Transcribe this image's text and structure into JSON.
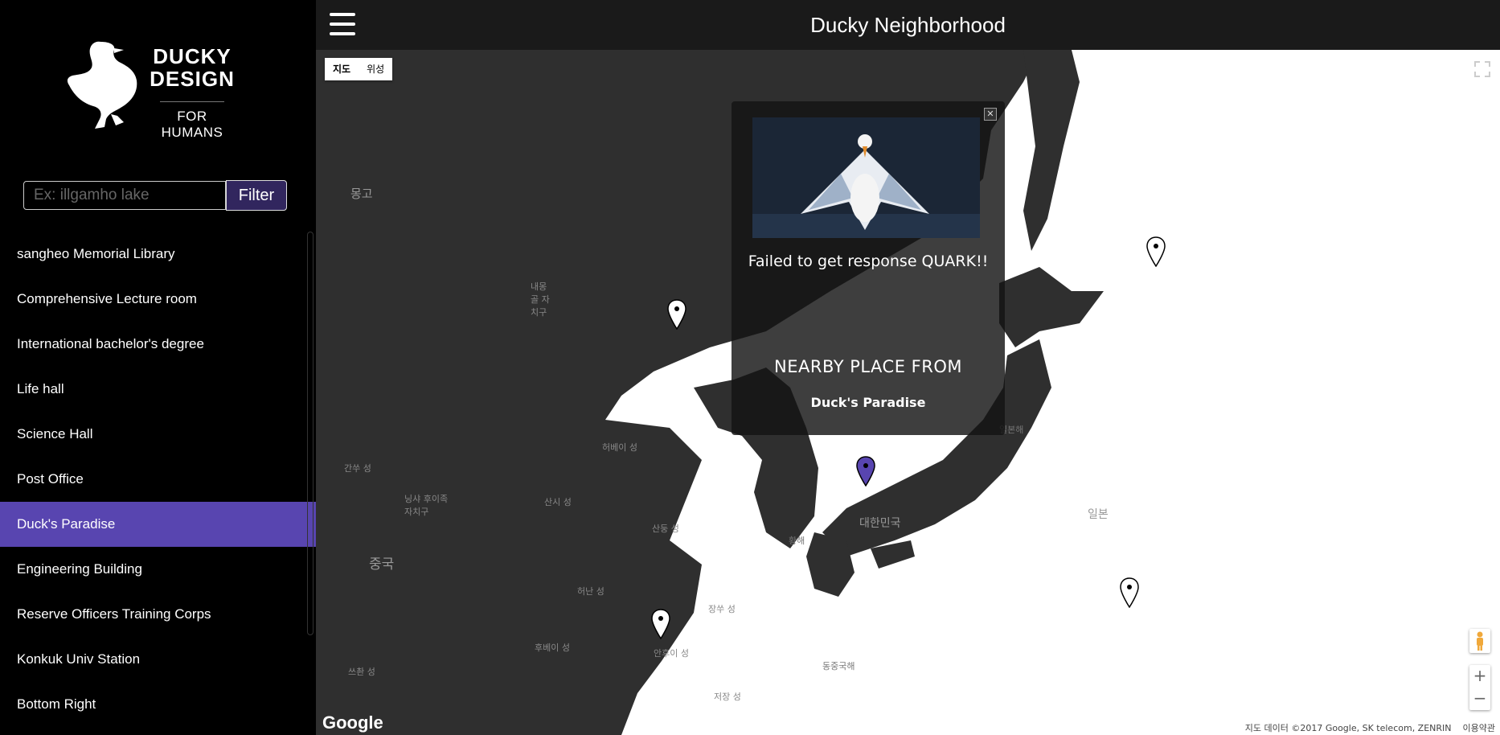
{
  "logo": {
    "line1": "DUCKY",
    "line2": "DESIGN",
    "subtitle": "FOR HUMANS",
    "icon": "duck-icon"
  },
  "filter": {
    "placeholder": "Ex: illgamho lake",
    "value": "",
    "button_label": "Filter"
  },
  "places": [
    {
      "label": "sangheo Memorial Library",
      "active": false
    },
    {
      "label": "Comprehensive Lecture room",
      "active": false
    },
    {
      "label": "International bachelor's degree",
      "active": false
    },
    {
      "label": "Life hall",
      "active": false
    },
    {
      "label": "Science Hall",
      "active": false
    },
    {
      "label": "Post Office",
      "active": false
    },
    {
      "label": "Duck's Paradise",
      "active": true
    },
    {
      "label": "Engineering Building",
      "active": false
    },
    {
      "label": "Reserve Officers Training Corps",
      "active": false
    },
    {
      "label": "Konkuk Univ Station",
      "active": false
    },
    {
      "label": "Bottom Right",
      "active": false
    }
  ],
  "header": {
    "title": "Ducky Neighborhood",
    "menu_icon": "hamburger-icon"
  },
  "map": {
    "type_options": [
      "지도",
      "위성"
    ],
    "selected_type": "지도",
    "labels": {
      "mongolia": "몽고",
      "inner_mongolia": "내몽골 자치구",
      "gansu": "간쑤 성",
      "ningxia": "닝샤 후이족 자치구",
      "shaanxi": "산시 성",
      "hebei": "허베이 성",
      "shandong": "산둥 성",
      "henan": "허난 성",
      "jiangsu": "장쑤 성",
      "hubei": "후베이 성",
      "anhui": "안후이 성",
      "sichuan": "쓰촨 성",
      "zhejiang": "저장 성",
      "china": "중국",
      "yellow_sea": "황해",
      "east_china_sea": "동중국해",
      "korea": "대한민국",
      "east_sea": "일본해",
      "japan": "일본"
    },
    "attribution": "지도 데이터 ©2017 Google, SK telecom, ZENRIN",
    "terms": "이용약관",
    "google": "Google",
    "accent": "#5845b0",
    "land_color": "#2f2f2f",
    "water_color": "#ffffff"
  },
  "info_window": {
    "error_text": "Failed to get response QUARK!!",
    "nearby_heading": "NEARBY PLACE FROM",
    "place_name": "Duck's Paradise",
    "close_icon": "close-icon",
    "photo": "duck-photo"
  },
  "controls": {
    "zoom_in": "+",
    "zoom_out": "−"
  }
}
